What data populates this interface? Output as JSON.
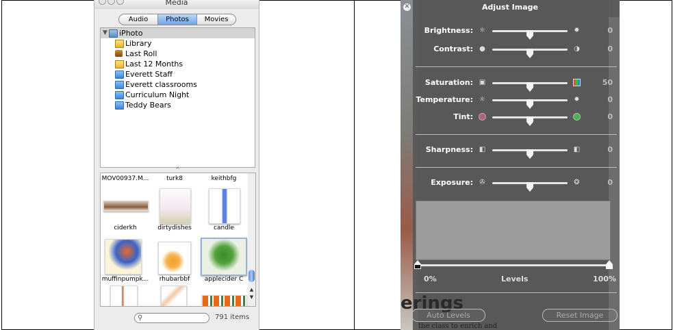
{
  "media": {
    "window_title": "Media",
    "tabs": [
      {
        "label": "Audio",
        "active": false
      },
      {
        "label": "Photos",
        "active": true
      },
      {
        "label": "Movies",
        "active": false
      }
    ],
    "tree": {
      "root": {
        "label": "iPhoto",
        "icon": "iphoto-icon"
      },
      "items": [
        {
          "label": "Library",
          "icon": "library-icon"
        },
        {
          "label": "Last Roll",
          "icon": "last-roll-icon"
        },
        {
          "label": "Last 12 Months",
          "icon": "calendar-icon"
        },
        {
          "label": "Everett Staff",
          "icon": "album-icon"
        },
        {
          "label": "Everett classrooms",
          "icon": "album-icon"
        },
        {
          "label": "Curriculum Night",
          "icon": "album-icon"
        },
        {
          "label": "Teddy Bears",
          "icon": "album-icon"
        }
      ]
    },
    "thumbnails": [
      {
        "caption": "MOV00937.M..."
      },
      {
        "caption": "turk8"
      },
      {
        "caption": "keithbfg"
      },
      {
        "caption": "ciderkh"
      },
      {
        "caption": "dirtydishes"
      },
      {
        "caption": "candle"
      },
      {
        "caption": "muffinpumpk..."
      },
      {
        "caption": "rhubarbbf"
      },
      {
        "caption": "applecider C"
      },
      {
        "caption": ""
      },
      {
        "caption": ""
      },
      {
        "caption": ""
      }
    ],
    "search": {
      "placeholder": "",
      "value": ""
    },
    "item_count": "791 items"
  },
  "adjust": {
    "title": "Adjust Image",
    "sliders": [
      {
        "label": "Brightness:",
        "value": "0",
        "level": 0.5
      },
      {
        "label": "Contrast:",
        "value": "0",
        "level": 0.5
      },
      {
        "label": "Saturation:",
        "value": "50",
        "level": 0.5
      },
      {
        "label": "Temperature:",
        "value": "0",
        "level": 0.5
      },
      {
        "label": "Tint:",
        "value": "0",
        "level": 0.5
      },
      {
        "label": "Sharpness:",
        "value": "0",
        "level": 0.5
      },
      {
        "label": "Exposure:",
        "value": "0",
        "level": 0.5
      }
    ],
    "levels": {
      "label": "Levels",
      "min_label": "0%",
      "max_label": "100%",
      "low": 0.0,
      "high": 1.0
    },
    "buttons": {
      "auto_levels": "Auto Levels",
      "reset_image": "Reset Image"
    },
    "background_text": {
      "heading": "erings",
      "line": "the class to enrich and"
    }
  },
  "colors": {
    "panel_bg": "#5c5c5c",
    "selected_tab": "#6ea6e9",
    "scroll_thumb": "#4f8fe0"
  }
}
